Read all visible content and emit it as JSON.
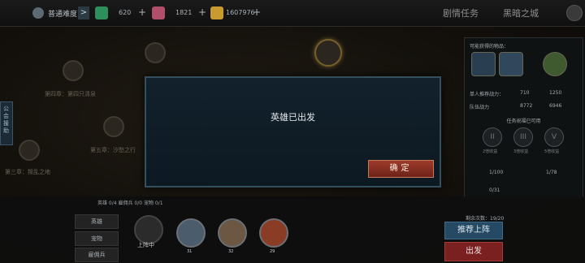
{
  "topbar": {
    "difficulty": "普通难度",
    "difficulty_arrow": ">",
    "resources": [
      {
        "name": "green-gem",
        "value": "620",
        "color": "#2f8f5a"
      },
      {
        "name": "pink-crystal",
        "value": "1821",
        "color": "#b04f6a"
      },
      {
        "name": "gold-coin",
        "value": "1607976",
        "color": "#c99a2e"
      }
    ],
    "tabs": [
      "剧情任务",
      "黑暗之城"
    ]
  },
  "map": {
    "nodes": [
      {
        "label": "第四章：第四只清泉"
      },
      {
        "label": "第五章：汐愁之行"
      },
      {
        "label": "第三章：叛乱之地"
      }
    ]
  },
  "guild_tab": "公会援助",
  "side_panel": {
    "title": "可能获得的物品：",
    "rows": [
      {
        "label": "单人推荐战力：",
        "v1": "710",
        "v2": "1250"
      },
      {
        "label": "队伍战力",
        "v1": "8772",
        "v2": "6946"
      }
    ],
    "buffs_title": "任务祝福已可用",
    "seals": [
      {
        "glyph": "II",
        "label": "2倍收益"
      },
      {
        "glyph": "III",
        "label": "3倍收益"
      },
      {
        "glyph": "V",
        "label": "5倍收益"
      }
    ],
    "counters": [
      "1/100",
      "1/78",
      "0/31"
    ]
  },
  "bottom": {
    "tags": "英雄 0/4   雇佣兵 0/0   宠物 0/1",
    "side_buttons": [
      "英雄",
      "宠物",
      "雇佣兵"
    ],
    "slot_label": "上阵中",
    "hero_levels": [
      "31",
      "32",
      "29"
    ],
    "dispatch_count": "剩余次数：19/20",
    "recommend_btn": "推荐上阵",
    "go_btn": "出发"
  },
  "modal": {
    "message": "英雄已出发",
    "ok_label": "确定"
  }
}
